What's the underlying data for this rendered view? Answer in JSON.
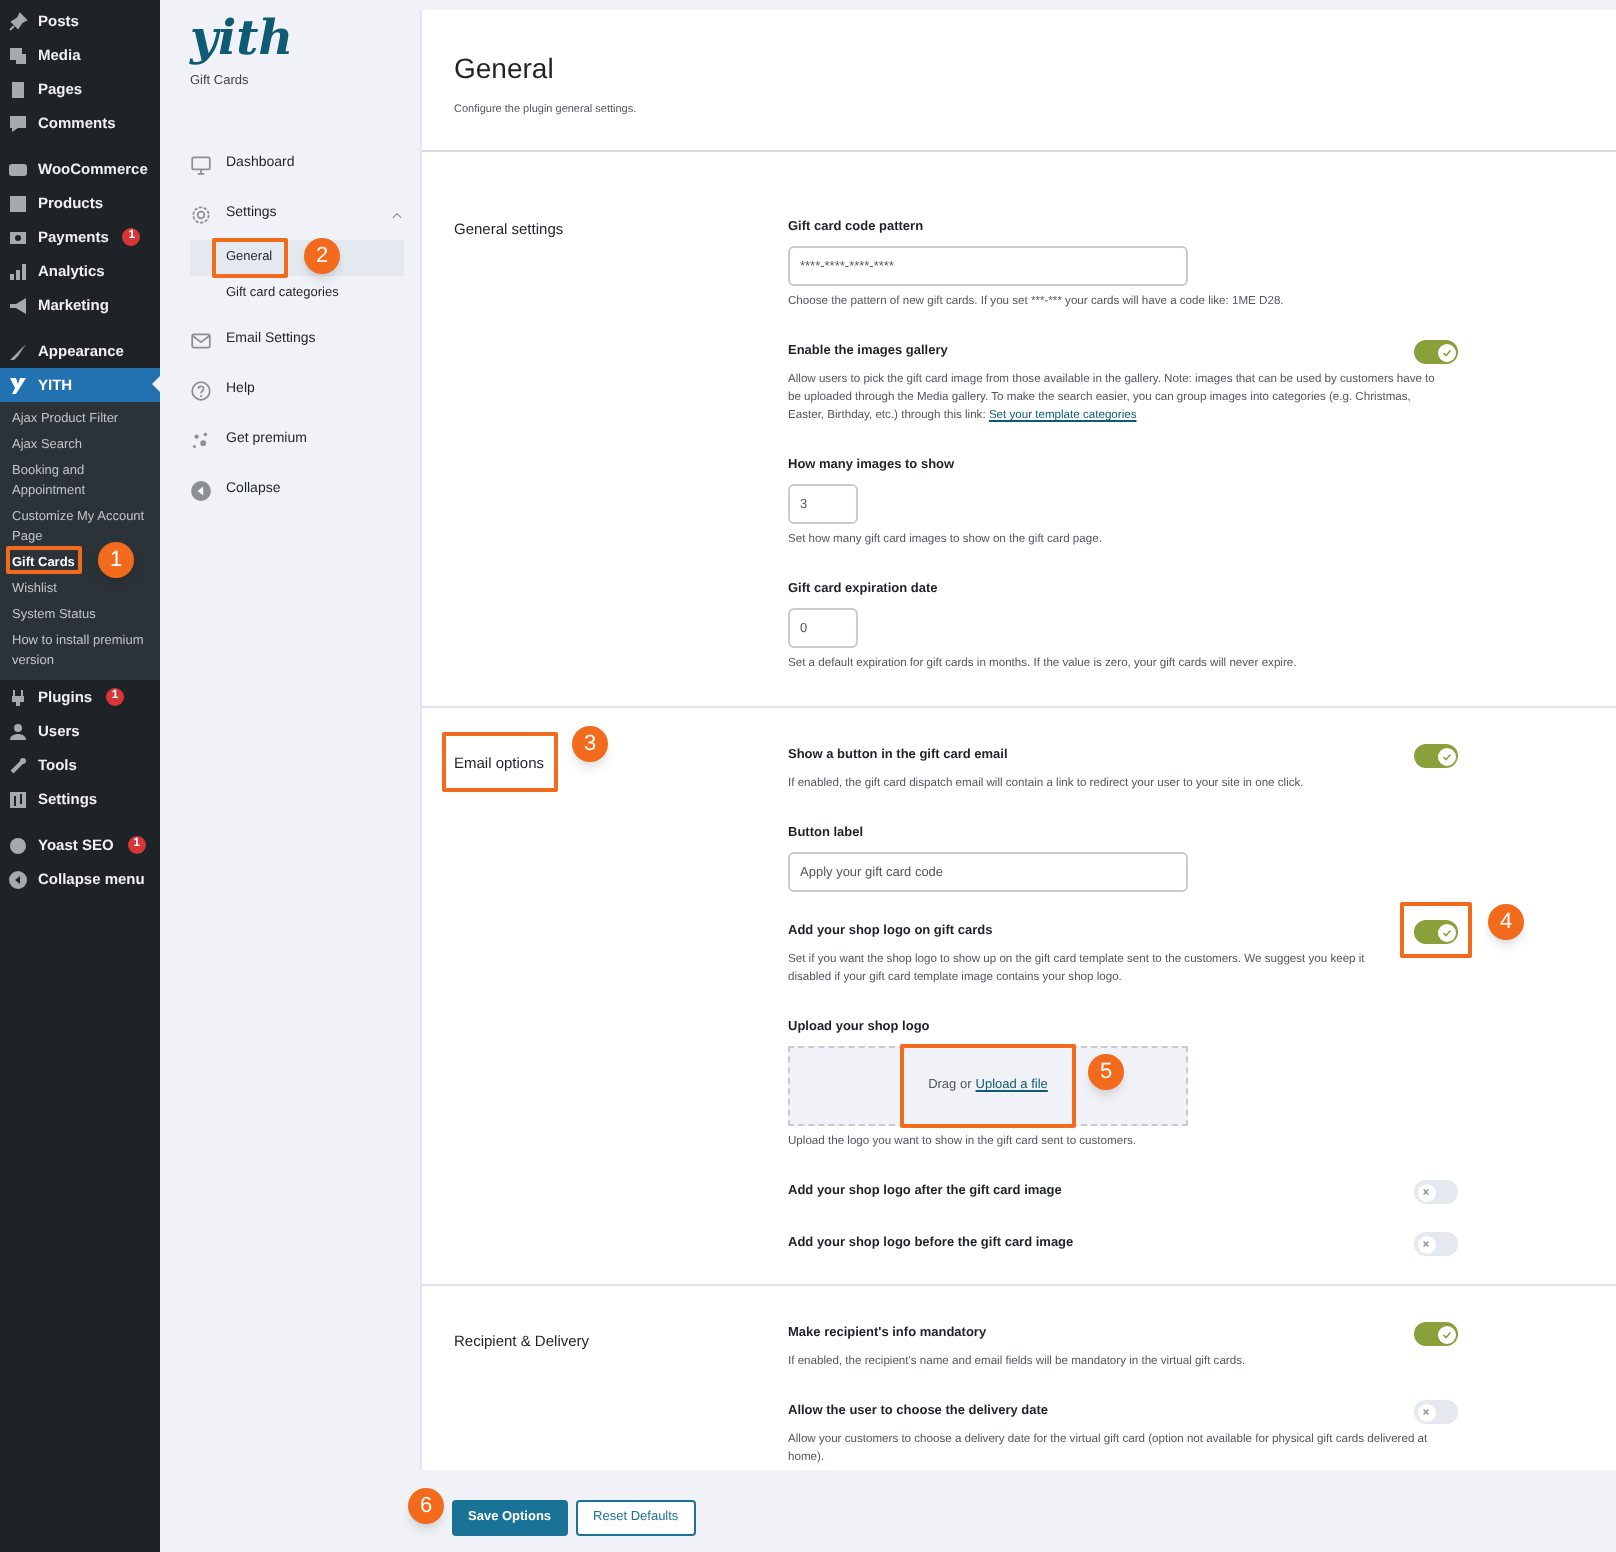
{
  "wp_menu": [
    [
      {
        "label": "Posts",
        "selected": false
      },
      {
        "label": "Media",
        "selected": false
      },
      {
        "label": "Pages",
        "selected": false
      },
      {
        "label": "Comments",
        "selected": false
      }
    ],
    [
      {
        "label": "WooCommerce",
        "selected": false
      },
      {
        "label": "Products",
        "selected": false
      },
      {
        "label": "Payments",
        "badge": "1",
        "selected": false
      },
      {
        "label": "Analytics",
        "selected": false
      },
      {
        "label": "Marketing",
        "selected": false
      }
    ],
    [
      {
        "label": "Appearance",
        "selected": false
      },
      {
        "label": "YITH",
        "selected": true,
        "submenu": [
          {
            "label": "Ajax Product Filter",
            "selected": false
          },
          {
            "label": "Ajax Search",
            "selected": false
          },
          {
            "label": "Booking and Appointment",
            "selected": false
          },
          {
            "label": "Customize My Account Page",
            "selected": false
          },
          {
            "label": "Gift Cards",
            "selected": true
          },
          {
            "label": "Wishlist",
            "selected": false
          },
          {
            "label": "System Status",
            "selected": false
          },
          {
            "label": "How to install premium version",
            "selected": false
          }
        ]
      },
      {
        "label": "Plugins",
        "badge": "1",
        "selected": false
      },
      {
        "label": "Users",
        "selected": false
      },
      {
        "label": "Tools",
        "selected": false
      },
      {
        "label": "Settings",
        "selected": false
      }
    ],
    [
      {
        "label": "Yoast SEO",
        "badge": "1",
        "selected": false
      },
      {
        "label": "Collapse menu",
        "selected": false
      }
    ]
  ],
  "plugin_panel": {
    "logo": "yith",
    "subtitle": "Gift Cards",
    "nav": [
      {
        "label": "Dashboard",
        "selected": false
      },
      {
        "label": "Settings",
        "selected": false,
        "expanded": true,
        "children": [
          {
            "label": "General",
            "selected": true
          },
          {
            "label": "Gift card categories",
            "selected": false
          }
        ]
      },
      {
        "label": "Email Settings",
        "selected": false
      },
      {
        "label": "Help",
        "selected": false
      },
      {
        "label": "Get premium",
        "selected": false
      },
      {
        "label": "Collapse",
        "selected": false
      }
    ]
  },
  "page": {
    "title": "General",
    "subtitle": "Configure the plugin general settings.",
    "sections": [
      {
        "title": "General settings",
        "fields": [
          {
            "kind": "text",
            "label": "Gift card code pattern",
            "value": "****-****-****-****",
            "description": "Choose the pattern of new gift cards. If you set ***-*** your cards will have a code like: 1ME D28."
          },
          {
            "kind": "toggle",
            "label": "Enable the images gallery",
            "on": true,
            "description": "Allow users to pick the gift card image from those available in the gallery. Note: images that can be used by customers have to be uploaded through the Media gallery. To make the search easier, you can group images into categories (e.g. Christmas, Easter, Birthday, etc.) through this link:",
            "link": "Set your template categories"
          },
          {
            "kind": "number",
            "label": "How many images to show",
            "value": "3",
            "description": "Set how many gift card images to show on the gift card page."
          },
          {
            "kind": "number",
            "label": "Gift card expiration date",
            "value": "0",
            "description": "Set a default expiration for gift cards in months. If the value is zero, your gift cards will never expire."
          }
        ]
      },
      {
        "title": "Email options",
        "fields": [
          {
            "kind": "toggle",
            "label": "Show a button in the gift card email",
            "on": true,
            "description": "If enabled, the gift card dispatch email will contain a link to redirect your user to your site in one click."
          },
          {
            "kind": "text",
            "label": "Button label",
            "value": "Apply your gift card code"
          },
          {
            "kind": "toggle",
            "label": "Add your shop logo on gift cards",
            "on": true,
            "description": "Set if you want the shop logo to show up on the gift card template sent to the customers. We suggest you keep it disabled if your gift card template image contains your shop logo."
          },
          {
            "kind": "upload",
            "label": "Upload your shop logo",
            "prompt": "Drag or",
            "link": "Upload a file",
            "description": "Upload the logo you want to show in the gift card sent to customers."
          },
          {
            "kind": "toggle",
            "label": "Add your shop logo after the gift card image",
            "on": false
          },
          {
            "kind": "toggle",
            "label": "Add your shop logo before the gift card image",
            "on": false
          }
        ]
      },
      {
        "title": "Recipient & Delivery",
        "fields": [
          {
            "kind": "toggle",
            "label": "Make recipient's info mandatory",
            "on": true,
            "description": "If enabled, the recipient's name and email fields will be mandatory in the virtual gift cards."
          },
          {
            "kind": "toggle",
            "label": "Allow the user to choose the delivery date",
            "on": false,
            "description": "Allow your customers to choose a delivery date for the virtual gift card (option not available for physical gift cards delivered at home)."
          }
        ]
      }
    ]
  },
  "buttons": [
    {
      "label": "Save Options",
      "kind": "primary"
    },
    {
      "label": "Reset Defaults",
      "kind": "secondary"
    }
  ],
  "callouts": [
    {
      "number": "1"
    },
    {
      "number": "2"
    },
    {
      "number": "3"
    },
    {
      "number": "4"
    },
    {
      "number": "5"
    },
    {
      "number": "6"
    }
  ]
}
